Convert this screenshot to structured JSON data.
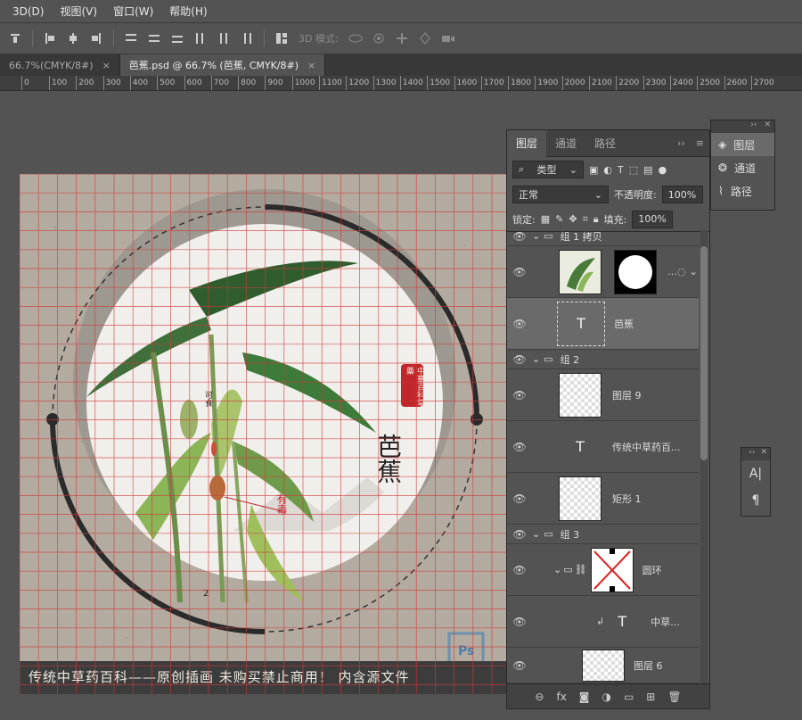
{
  "menu": [
    "3D(D)",
    "视图(V)",
    "窗口(W)",
    "帮助(H)"
  ],
  "options": {
    "mode3d_label": "3D 模式:"
  },
  "tabs": [
    {
      "label": "66.7%(CMYK/8#)",
      "close": "×"
    },
    {
      "label": "芭蕉.psd @ 66.7% (芭蕉, CMYK/8#)",
      "close": "×"
    }
  ],
  "ruler": [
    "0",
    "100",
    "200",
    "300",
    "400",
    "500",
    "600",
    "700",
    "800",
    "900",
    "1000",
    "1100",
    "1200",
    "1300",
    "1400",
    "1500",
    "1600",
    "1700",
    "1800",
    "1900",
    "2000",
    "2100",
    "2200",
    "2300",
    "2400",
    "2500",
    "2600",
    "2700"
  ],
  "artwork": {
    "title": "芭蕉",
    "label_edible": "可食",
    "label_toxic": "有毒",
    "seal_text": "中華百科草藥",
    "number": "2",
    "banner": "传统中草药百科——原创插画 未购买禁止商用！ 内含源文件",
    "watermark": "Ps"
  },
  "layers_panel": {
    "tabs": [
      "图层",
      "通道",
      "路径"
    ],
    "filter_label": "类型",
    "blend_mode": "正常",
    "opacity_label": "不透明度:",
    "opacity_value": "100%",
    "lock_label": "锁定:",
    "fill_label": "填充:",
    "fill_value": "100%",
    "layers": [
      {
        "name": "组 1 拷贝",
        "type": "group"
      },
      {
        "name": "",
        "type": "masked"
      },
      {
        "name": "芭蕉",
        "type": "text"
      },
      {
        "name": "组 2",
        "type": "group"
      },
      {
        "name": "图层 9",
        "type": "pixel"
      },
      {
        "name": "传统中草药百...",
        "type": "text"
      },
      {
        "name": "矩形 1",
        "type": "shape"
      },
      {
        "name": "组 3",
        "type": "group"
      },
      {
        "name": "圆环",
        "type": "shape"
      },
      {
        "name": "中草...",
        "type": "text"
      },
      {
        "name": "图层 6",
        "type": "pixel"
      }
    ],
    "footer_icons": [
      "link-icon",
      "fx-icon",
      "mask-icon",
      "adjustment-icon",
      "folder-icon",
      "new-layer-icon",
      "trash-icon"
    ]
  },
  "mini_panel": {
    "items": [
      "图层",
      "通道",
      "路径"
    ]
  },
  "colors": {
    "accent_red": "#c0262a",
    "grid_red": "#d23a3a"
  }
}
